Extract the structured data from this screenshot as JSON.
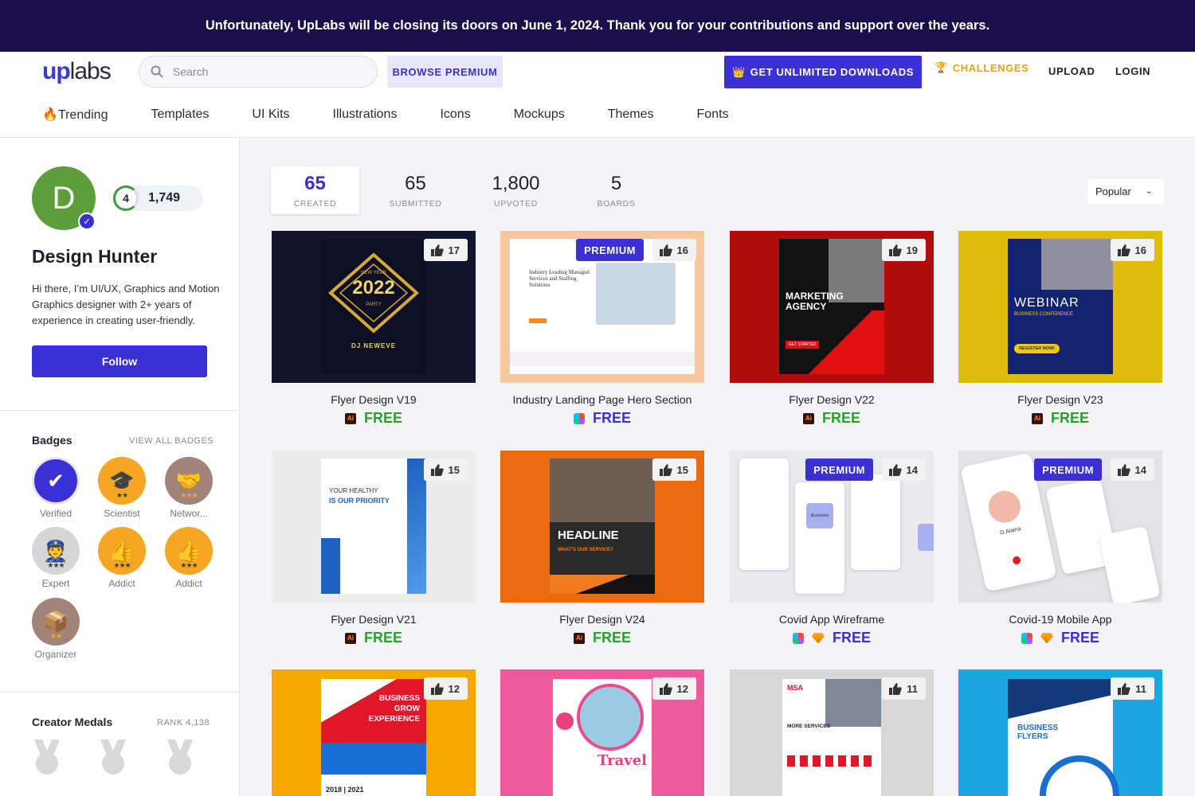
{
  "banner": {
    "text": "Unfortunately, UpLabs will be closing its doors on June 1, 2024. Thank you for your contributions and support over the years."
  },
  "header": {
    "logo_up": "up",
    "logo_labs": "labs",
    "search_placeholder": "Search",
    "browse_premium": "BROWSE PREMIUM",
    "get_unlimited": "GET UNLIMITED DOWNLOADS",
    "challenges": "CHALLENGES",
    "upload": "UPLOAD",
    "login": "LOGIN"
  },
  "categories": [
    "🔥Trending",
    "Templates",
    "UI Kits",
    "Illustrations",
    "Icons",
    "Mockups",
    "Themes",
    "Fonts"
  ],
  "profile": {
    "initial": "D",
    "level": "4",
    "points": "1,749",
    "name": "Design Hunter",
    "bio": "Hi there, I’m UI/UX, Graphics and Motion Graphics designer with 2+ years of experience in creating user-friendly.",
    "follow": "Follow"
  },
  "badges": {
    "title": "Badges",
    "view_all": "VIEW ALL BADGES",
    "items": [
      {
        "label": "Verified",
        "icon": "check-icon",
        "color": "#3b2fd6"
      },
      {
        "label": "Scientist",
        "icon": "mortarboard-icon",
        "color": "#f5a623"
      },
      {
        "label": "Networ...",
        "icon": "handshake-icon",
        "color": "#a08478"
      },
      {
        "label": "Expert",
        "icon": "expert-icon",
        "color": "#d6d6d6"
      },
      {
        "label": "Addict",
        "icon": "thumbs-up-icon",
        "color": "#f5a623"
      },
      {
        "label": "Addict",
        "icon": "thumbs-up-icon",
        "color": "#f5a623"
      },
      {
        "label": "Organizer",
        "icon": "box-icon",
        "color": "#a08478"
      }
    ]
  },
  "medals": {
    "title": "Creator Medals",
    "rank": "RANK 4,138"
  },
  "stats": [
    {
      "num": "65",
      "label": "CREATED"
    },
    {
      "num": "65",
      "label": "SUBMITTED"
    },
    {
      "num": "1,800",
      "label": "UPVOTED"
    },
    {
      "num": "5",
      "label": "BOARDS"
    }
  ],
  "sort": "Popular",
  "free_label": "FREE",
  "premium_label": "PREMIUM",
  "cards": [
    {
      "title": "Flyer Design V19",
      "likes": "17",
      "premium": false,
      "tools": [
        "ai"
      ],
      "bg": "#12152b"
    },
    {
      "title": "Industry Landing Page Hero Section",
      "likes": "16",
      "premium": true,
      "tools": [
        "figma"
      ],
      "bg": "#f7c7a0"
    },
    {
      "title": "Flyer Design V22",
      "likes": "19",
      "premium": false,
      "tools": [
        "ai"
      ],
      "bg": "#b00d0d"
    },
    {
      "title": "Flyer Design V23",
      "likes": "16",
      "premium": false,
      "tools": [
        "ai"
      ],
      "bg": "#e0bc0e"
    },
    {
      "title": "Flyer Design V21",
      "likes": "15",
      "premium": false,
      "tools": [
        "ai"
      ],
      "bg": "#ececec"
    },
    {
      "title": "Flyer Design V24",
      "likes": "15",
      "premium": false,
      "tools": [
        "ai"
      ],
      "bg": "#ea6a10"
    },
    {
      "title": "Covid App Wireframe",
      "likes": "14",
      "premium": true,
      "tools": [
        "figma",
        "sketch"
      ],
      "bg": "#e9e9ee"
    },
    {
      "title": "Covid-19 Mobile App",
      "likes": "14",
      "premium": true,
      "tools": [
        "figma",
        "sketch"
      ],
      "bg": "#e4e4e8"
    },
    {
      "title": "",
      "likes": "12",
      "premium": false,
      "tools": [],
      "bg": "#f5a800"
    },
    {
      "title": "",
      "likes": "12",
      "premium": false,
      "tools": [],
      "bg": "#ec5a9c"
    },
    {
      "title": "",
      "likes": "11",
      "premium": false,
      "tools": [],
      "bg": "#d7d7d7"
    },
    {
      "title": "",
      "likes": "11",
      "premium": false,
      "tools": [],
      "bg": "#1ca7e0"
    }
  ],
  "posters": {
    "v19": {
      "top": "NEW YEAR",
      "year": "2022",
      "party": "PARTY",
      "dj": "DJ NEWEVE"
    },
    "industry": {
      "heading": "Industry Leading Managed Services and Staffing Solutions"
    },
    "v22": {
      "title": "MARKETING AGENCY",
      "cta": "GET STARTED"
    },
    "v23": {
      "title": "WEBINAR",
      "sub": "BUSINESS CONFERENCE",
      "cta": "REGISTER NOW!"
    },
    "v21": {
      "head1": "YOUR HEALTHY",
      "head2": "IS OUR PRIORITY"
    },
    "v24": {
      "title": "HEADLINE",
      "sub": "WHAT'S OUR SERVICE?"
    },
    "wire": {
      "label": "Illustration"
    },
    "covid": {
      "name": "D.Alaina"
    },
    "r3a": {
      "title": "BUSINESS GROW EXPERIENCE",
      "year": "2018 | 2021"
    },
    "r3b": {
      "title": "Travel"
    },
    "r3c": {
      "title": "MORE SERVICES"
    },
    "r3d": {
      "title": "BUSINESS FLYERS"
    }
  }
}
